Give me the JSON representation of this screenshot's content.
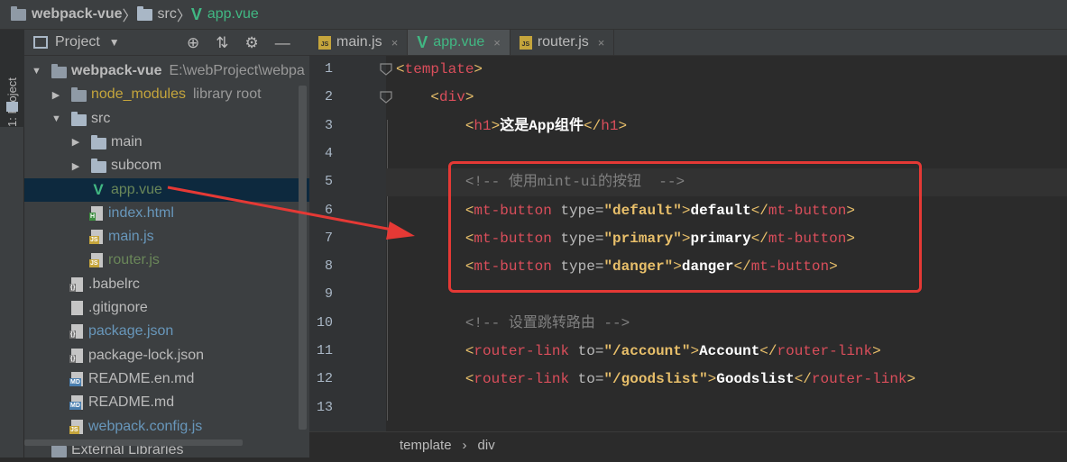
{
  "breadcrumb": {
    "project": "webpack-vue",
    "folder": "src",
    "file": "app.vue"
  },
  "toolstrip": {
    "label": "1: Project"
  },
  "project": {
    "title": "Project",
    "tree": [
      {
        "name": "webpack-vue",
        "extra": "E:\\webProject\\webpa",
        "indent": 0,
        "arrow": "▼",
        "type": "folder-dark",
        "color": "bold"
      },
      {
        "name": "node_modules",
        "extra": "library root",
        "indent": 1,
        "arrow": "▶",
        "type": "folder-dark",
        "color": "yellow"
      },
      {
        "name": "src",
        "extra": "",
        "indent": 1,
        "arrow": "▼",
        "type": "folder",
        "color": "normal"
      },
      {
        "name": "main",
        "extra": "",
        "indent": 2,
        "arrow": "▶",
        "type": "folder",
        "color": "normal"
      },
      {
        "name": "subcom",
        "extra": "",
        "indent": 2,
        "arrow": "▶",
        "type": "folder",
        "color": "normal"
      },
      {
        "name": "app.vue",
        "extra": "",
        "indent": 2,
        "arrow": "",
        "type": "vue",
        "color": "green",
        "selected": true
      },
      {
        "name": "index.html",
        "extra": "",
        "indent": 2,
        "arrow": "",
        "type": "html",
        "color": "blue"
      },
      {
        "name": "main.js",
        "extra": "",
        "indent": 2,
        "arrow": "",
        "type": "js",
        "color": "blue"
      },
      {
        "name": "router.js",
        "extra": "",
        "indent": 2,
        "arrow": "",
        "type": "js",
        "color": "green"
      },
      {
        "name": ".babelrc",
        "extra": "",
        "indent": 1,
        "arrow": "",
        "type": "cfg",
        "color": "normal"
      },
      {
        "name": ".gitignore",
        "extra": "",
        "indent": 1,
        "arrow": "",
        "type": "doc",
        "color": "normal"
      },
      {
        "name": "package.json",
        "extra": "",
        "indent": 1,
        "arrow": "",
        "type": "cfg",
        "color": "blue"
      },
      {
        "name": "package-lock.json",
        "extra": "",
        "indent": 1,
        "arrow": "",
        "type": "cfg",
        "color": "normal"
      },
      {
        "name": "README.en.md",
        "extra": "",
        "indent": 1,
        "arrow": "",
        "type": "md",
        "color": "normal"
      },
      {
        "name": "README.md",
        "extra": "",
        "indent": 1,
        "arrow": "",
        "type": "md",
        "color": "normal"
      },
      {
        "name": "webpack.config.js",
        "extra": "",
        "indent": 1,
        "arrow": "",
        "type": "js",
        "color": "blue"
      },
      {
        "name": "External Libraries",
        "extra": "",
        "indent": 0,
        "arrow": "",
        "type": "lib",
        "color": "normal"
      }
    ]
  },
  "tabs": [
    {
      "label": "main.js",
      "icon": "js",
      "active": false
    },
    {
      "label": "app.vue",
      "icon": "vue",
      "active": true
    },
    {
      "label": "router.js",
      "icon": "js",
      "active": false
    }
  ],
  "close_glyph": "×",
  "code_lines": [
    [
      [
        "tg",
        "<"
      ],
      [
        "nm",
        "template"
      ],
      [
        "tg",
        ">"
      ]
    ],
    [
      [
        "t",
        "    "
      ],
      [
        "tg",
        "<"
      ],
      [
        "nm",
        "div"
      ],
      [
        "tg",
        ">"
      ]
    ],
    [
      [
        "t",
        "        "
      ],
      [
        "tg",
        "<"
      ],
      [
        "nm",
        "h1"
      ],
      [
        "tg",
        ">"
      ],
      [
        "txt",
        "这是App组件"
      ],
      [
        "tg",
        "</"
      ],
      [
        "nm",
        "h1"
      ],
      [
        "tg",
        ">"
      ]
    ],
    [
      [
        "t",
        ""
      ]
    ],
    [
      [
        "t",
        "        "
      ],
      [
        "cm",
        "<!-- 使用mint-ui的按钮  -->"
      ]
    ],
    [
      [
        "t",
        "        "
      ],
      [
        "tg",
        "<"
      ],
      [
        "nm",
        "mt-button "
      ],
      [
        "at",
        "type="
      ],
      [
        "str",
        "\"default\""
      ],
      [
        "tg",
        ">"
      ],
      [
        "txt",
        "default"
      ],
      [
        "tg",
        "</"
      ],
      [
        "nm",
        "mt-button"
      ],
      [
        "tg",
        ">"
      ]
    ],
    [
      [
        "t",
        "        "
      ],
      [
        "tg",
        "<"
      ],
      [
        "nm",
        "mt-button "
      ],
      [
        "at",
        "type="
      ],
      [
        "str",
        "\"primary\""
      ],
      [
        "tg",
        ">"
      ],
      [
        "txt",
        "primary"
      ],
      [
        "tg",
        "</"
      ],
      [
        "nm",
        "mt-button"
      ],
      [
        "tg",
        ">"
      ]
    ],
    [
      [
        "t",
        "        "
      ],
      [
        "tg",
        "<"
      ],
      [
        "nm",
        "mt-button "
      ],
      [
        "at",
        "type="
      ],
      [
        "str",
        "\"danger\""
      ],
      [
        "tg",
        ">"
      ],
      [
        "txt",
        "danger"
      ],
      [
        "tg",
        "</"
      ],
      [
        "nm",
        "mt-button"
      ],
      [
        "tg",
        ">"
      ]
    ],
    [
      [
        "t",
        ""
      ]
    ],
    [
      [
        "t",
        "        "
      ],
      [
        "cm",
        "<!-- 设置跳转路由 -->"
      ]
    ],
    [
      [
        "t",
        "        "
      ],
      [
        "tg",
        "<"
      ],
      [
        "nm",
        "router-link "
      ],
      [
        "at",
        "to="
      ],
      [
        "str",
        "\"/account\""
      ],
      [
        "tg",
        ">"
      ],
      [
        "txt",
        "Account"
      ],
      [
        "tg",
        "</"
      ],
      [
        "nm",
        "router-link"
      ],
      [
        "tg",
        ">"
      ]
    ],
    [
      [
        "t",
        "        "
      ],
      [
        "tg",
        "<"
      ],
      [
        "nm",
        "router-link "
      ],
      [
        "at",
        "to="
      ],
      [
        "str",
        "\"/goodslist\""
      ],
      [
        "tg",
        ">"
      ],
      [
        "txt",
        "Goodslist"
      ],
      [
        "tg",
        "</"
      ],
      [
        "nm",
        "router-link"
      ],
      [
        "tg",
        ">"
      ]
    ],
    [
      [
        "t",
        ""
      ]
    ]
  ],
  "line_numbers": [
    "1",
    "2",
    "3",
    "4",
    "5",
    "6",
    "7",
    "8",
    "9",
    "10",
    "11",
    "12",
    "13"
  ],
  "bottom_breadcrumb": {
    "first": "template",
    "separator": "›",
    "second": "div"
  },
  "colors": {
    "vue_green": "#41b883",
    "annotation_red": "#e53935",
    "selected_bg": "#0d293e"
  }
}
